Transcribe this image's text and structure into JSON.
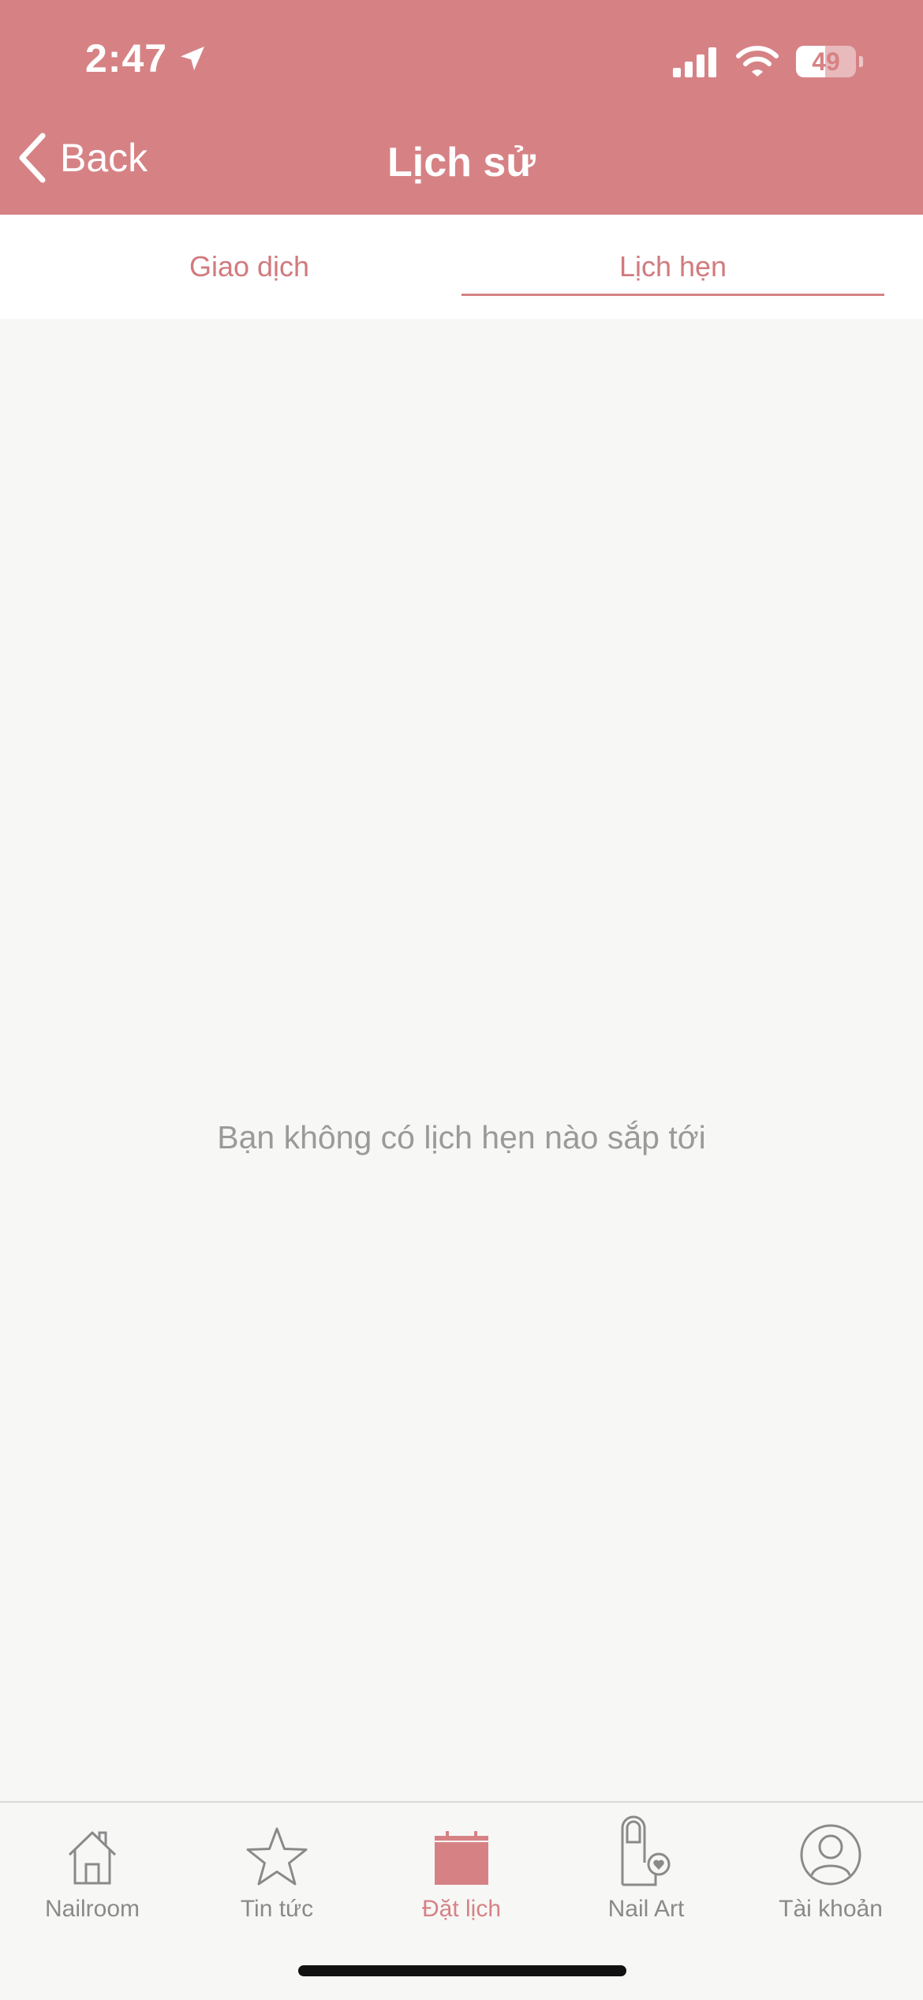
{
  "status_bar": {
    "time": "2:47",
    "battery": "49",
    "battery_level": 0.49
  },
  "header": {
    "back_label": "Back",
    "title": "Lịch sử"
  },
  "tabs": [
    {
      "label": "Giao dịch",
      "active": false
    },
    {
      "label": "Lịch hẹn",
      "active": true
    }
  ],
  "main": {
    "empty_message": "Bạn không có lịch hẹn nào sắp tới"
  },
  "tabbar": {
    "items": [
      {
        "label": "Nailroom",
        "icon": "house-icon",
        "active": false
      },
      {
        "label": "Tin tức",
        "icon": "star-icon",
        "active": false
      },
      {
        "label": "Đặt lịch",
        "icon": "calendar-icon",
        "active": true
      },
      {
        "label": "Nail Art",
        "icon": "nail-icon",
        "active": false
      },
      {
        "label": "Tài khoản",
        "icon": "user-icon",
        "active": false
      }
    ]
  },
  "colors": {
    "brand": "#d68285",
    "tab_text": "#d27a7e",
    "muted_text": "#9a9a9a",
    "background": "#f7f7f6"
  }
}
